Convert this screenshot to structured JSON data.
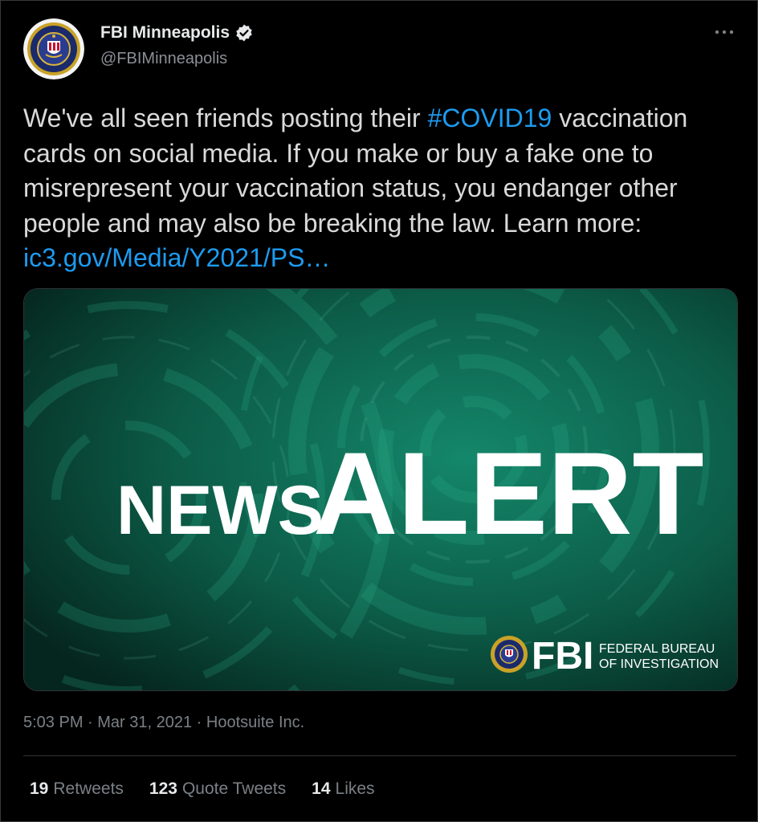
{
  "account": {
    "display_name": "FBI Minneapolis",
    "handle": "@FBIMinneapolis",
    "verified_icon": "verified-badge-icon"
  },
  "tweet": {
    "text_before_hashtag": "We've all seen friends posting their ",
    "hashtag": "#COVID19",
    "text_after_hashtag": " vaccination cards on social media. If you make or buy a fake one to misrepresent your vaccination status, you endanger other people and may also be breaking the law. Learn more: ",
    "link": "ic3.gov/Media/Y2021/PS…"
  },
  "media": {
    "word_news": "NEWS",
    "word_alert": "ALERT",
    "logo_text": "FBI",
    "logo_line1": "FEDERAL BUREAU",
    "logo_line2": "OF INVESTIGATION"
  },
  "meta": {
    "time": "5:03 PM",
    "date": "Mar 31, 2021",
    "source": "Hootsuite Inc.",
    "separator": " · "
  },
  "stats": {
    "retweets_count": "19",
    "retweets_label": "Retweets",
    "quotes_count": "123",
    "quotes_label": "Quote Tweets",
    "likes_count": "14",
    "likes_label": "Likes"
  },
  "colors": {
    "background": "#000000",
    "link": "#1d9bf0",
    "card_green": "#0b5a45"
  }
}
